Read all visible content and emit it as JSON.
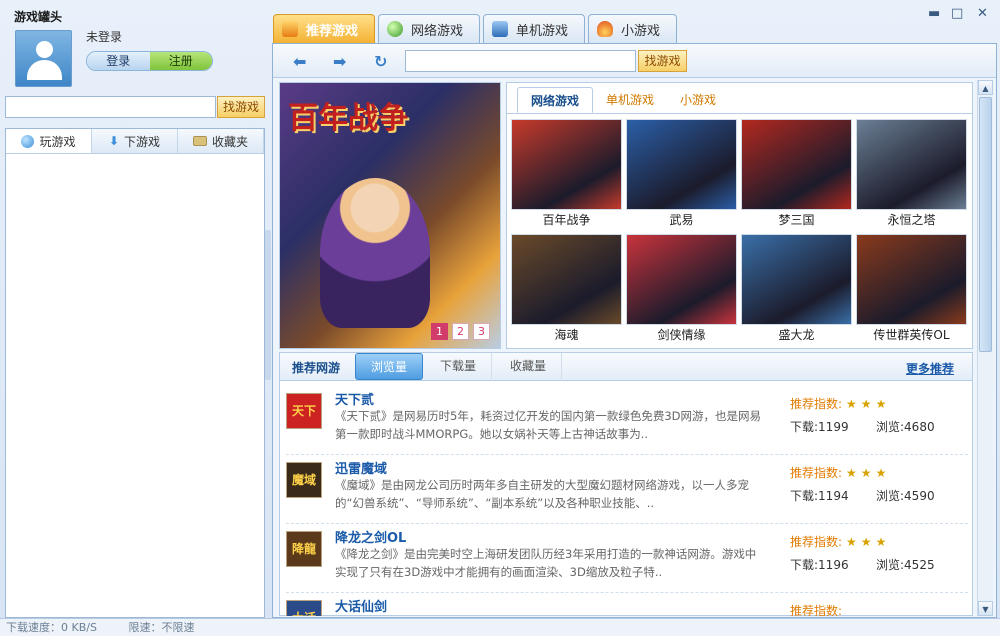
{
  "app": {
    "title": "游戏罐头"
  },
  "user": {
    "status": "未登录",
    "login_label": "登录",
    "register_label": "注册"
  },
  "left_search": {
    "value": "",
    "button": "找游戏"
  },
  "left_tabs": [
    {
      "label": "玩游戏",
      "icon": "globe-icon"
    },
    {
      "label": "下游戏",
      "icon": "download-icon"
    },
    {
      "label": "收藏夹",
      "icon": "folder-icon"
    }
  ],
  "status_bar": {
    "speed": "下载速度：0 KB/S",
    "limit": "限速：不限速"
  },
  "top_tabs": [
    {
      "label": "推荐游戏",
      "active": true
    },
    {
      "label": "网络游戏"
    },
    {
      "label": "单机游戏"
    },
    {
      "label": "小游戏"
    }
  ],
  "toolbar": {
    "search_value": "",
    "search_button": "找游戏"
  },
  "banner": {
    "title": "百年战争",
    "pages": [
      "1",
      "2",
      "3"
    ],
    "current_page": "1"
  },
  "grid_tabs": [
    "网络游戏",
    "单机游戏",
    "小游戏"
  ],
  "grid_games": [
    {
      "name": "百年战争",
      "color": "#c73a2b"
    },
    {
      "name": "武易",
      "color": "#2b5fa8"
    },
    {
      "name": "梦三国",
      "color": "#b3281f"
    },
    {
      "name": "永恒之塔",
      "color": "#6b7f94"
    },
    {
      "name": "海魂",
      "color": "#6a4a2a"
    },
    {
      "name": "剑侠情缘",
      "color": "#c9333c"
    },
    {
      "name": "盛大龙",
      "color": "#3a6fa8"
    },
    {
      "name": "传世群英传OL",
      "color": "#8a3a1c"
    }
  ],
  "list": {
    "title": "推荐网游",
    "tabs": [
      "浏览量",
      "下载量",
      "收藏量"
    ],
    "more": "更多推荐",
    "items": [
      {
        "name": "天下贰",
        "icon_text": "天下",
        "desc": "《天下贰》是网易历时5年，耗资过亿开发的国内第一款绿色免费3D网游，也是网易第一款即时战斗MMORPG。她以女娲补天等上古神话故事为..",
        "rec": "推荐指数:",
        "stars": "★★★",
        "dl": "下载:1199",
        "views": "浏览:4680"
      },
      {
        "name": "迅雷魔域",
        "icon_text": "魔域",
        "desc": "《魔域》是由网龙公司历时两年多自主研发的大型魔幻题材网络游戏，以一人多宠的“幻兽系统”、“导师系统”、“副本系统”以及各种职业技能、..",
        "rec": "推荐指数:",
        "stars": "★★★",
        "dl": "下载:1194",
        "views": "浏览:4590"
      },
      {
        "name": "降龙之剑OL",
        "icon_text": "降龍",
        "desc": "《降龙之剑》是由完美时空上海研发团队历经3年采用打造的一款神话网游。游戏中实现了只有在3D游戏中才能拥有的画面渲染、3D缩放及粒子特..",
        "rec": "推荐指数:",
        "stars": "★★★",
        "dl": "下载:1196",
        "views": "浏览:4525"
      },
      {
        "name": "大话仙剑",
        "icon_text": "大话",
        "desc": "",
        "rec": "推荐指数:",
        "stars": "",
        "dl": "",
        "views": ""
      }
    ]
  }
}
